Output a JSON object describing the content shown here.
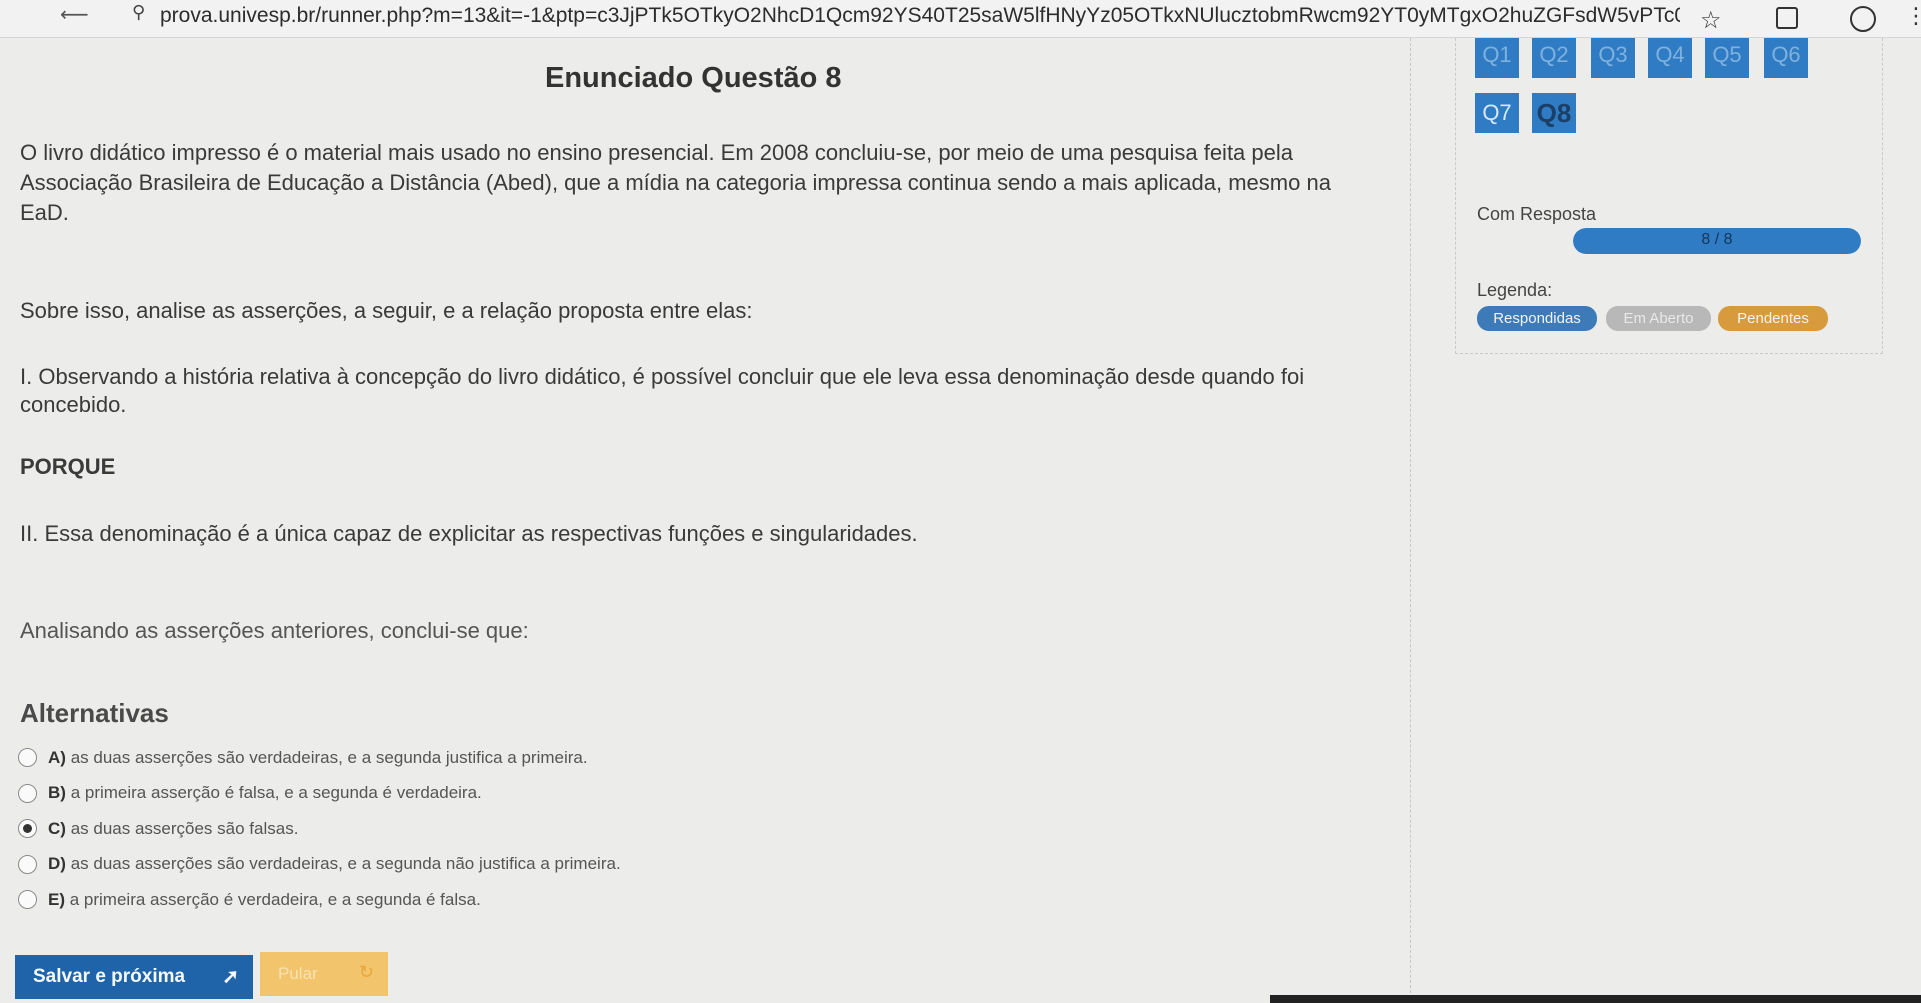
{
  "browser": {
    "url": "prova.univesp.br/runner.php?m=13&it=-1&ptp=c3JjPTk5OTkyO2NhcD1Qcm92YS40T25saW5lfHNyYz05OTkxNUlucztobmRwcm92YT0yMTgxO2huZGFsdW5vPTc0Nj..."
  },
  "question": {
    "title": "Enunciado Questão 8",
    "p1": "O livro didático impresso é o material mais usado no ensino presencial. Em 2008 concluiu-se, por meio de uma pesquisa feita pela Associação Brasileira de Educação a Distância (Abed), que a mídia na categoria impressa continua sendo a mais aplicada, mesmo na EaD.",
    "p2": "Sobre isso, analise as asserções, a seguir, e a relação proposta entre elas:",
    "p3": "I. Observando a história relativa à concepção do livro didático, é possível concluir que ele leva essa denominação desde quando foi concebido.",
    "p4": "PORQUE",
    "p5": "II. Essa denominação é a única capaz de explicitar as respectivas funções e singularidades.",
    "p6": "Analisando as asserções anteriores, conclui-se que:"
  },
  "alternatives": {
    "title": "Alternativas",
    "selected": "C",
    "items": [
      {
        "letter": "A)",
        "text": "as duas asserções são verdadeiras, e a segunda justifica a primeira."
      },
      {
        "letter": "B)",
        "text": "a primeira asserção é falsa, e a segunda é verdadeira."
      },
      {
        "letter": "C)",
        "text": "as duas asserções são falsas."
      },
      {
        "letter": "D)",
        "text": "as duas asserções são verdadeiras, e a segunda não justifica a primeira."
      },
      {
        "letter": "E)",
        "text": "a primeira asserção é verdadeira, e a segunda é falsa."
      }
    ]
  },
  "buttons": {
    "save": "Salvar e próxima",
    "skip": "Pular"
  },
  "nav": {
    "top_row": [
      "Q1",
      "Q2",
      "Q3",
      "Q4",
      "Q5",
      "Q6"
    ],
    "row2": [
      "Q7",
      "Q8"
    ],
    "current": "Q8",
    "answered_label": "Com Resposta",
    "progress_text": "8 / 8",
    "progress_fraction": 1.0,
    "legend_label": "Legenda:",
    "legend": [
      "Respondidas",
      "Em Aberto",
      "Pendentes"
    ]
  },
  "colors": {
    "primary": "#2f7cc4",
    "save_button": "#1f63a8",
    "skip_button": "#f2c46b",
    "legend_answered": "#3d7ab8",
    "legend_open": "#b8b8b8",
    "legend_pending": "#d79a3c"
  }
}
